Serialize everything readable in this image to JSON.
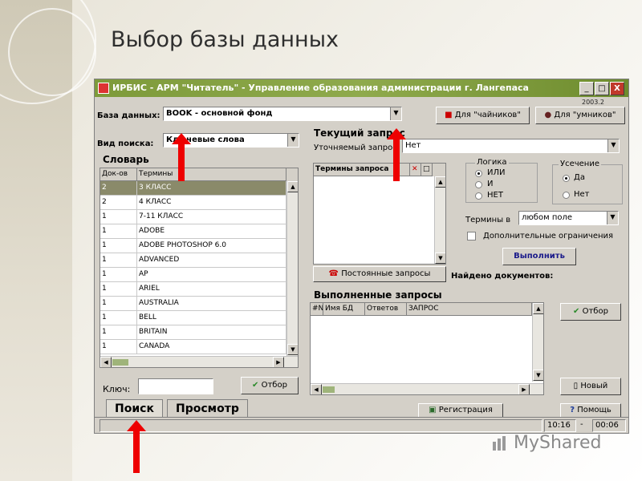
{
  "slide_title": "Выбор базы данных",
  "window": {
    "title": "ИРБИС - АРМ \"Читатель\" - Управление образования администрации г. Лангепаса",
    "version": "2003.2",
    "minimize": "_",
    "maximize": "□",
    "close": "X"
  },
  "db": {
    "label": "База данных:",
    "value": "BOOK - основной фонд",
    "btn_novice": "Для \"чайников\"",
    "btn_expert": "Для \"умников\""
  },
  "search_type": {
    "label": "Вид поиска:",
    "value": "Ключевые слова"
  },
  "dictionary": {
    "title": "Словарь",
    "headers": [
      "Док-ов",
      "Термины"
    ],
    "rows": [
      [
        "2",
        "3 КЛАСС"
      ],
      [
        "2",
        "4 КЛАСС"
      ],
      [
        "1",
        "7-11 КЛАСС"
      ],
      [
        "1",
        "ADOBE"
      ],
      [
        "1",
        "ADOBE PHOTOSHOP 6.0"
      ],
      [
        "1",
        "ADVANCED"
      ],
      [
        "1",
        "AP"
      ],
      [
        "1",
        "ARIEL"
      ],
      [
        "1",
        "AUSTRALIA"
      ],
      [
        "1",
        "BELL"
      ],
      [
        "1",
        "BRITAIN"
      ],
      [
        "1",
        "CANADA"
      ]
    ],
    "key_label": "Ключ:",
    "select_btn": "Отбор"
  },
  "current_query": {
    "title": "Текущий запрос",
    "refine_label": "Уточняемый запрос",
    "refine_value": "Нет",
    "terms_header": "Термины запроса",
    "logic_title": "Логика",
    "logic_or": "ИЛИ",
    "logic_and": "И",
    "logic_not": "НЕТ",
    "trunc_title": "Усечение",
    "trunc_yes": "Да",
    "trunc_no": "Нет",
    "terms_in_label": "Термины в",
    "terms_in_value": "любом поле",
    "extra_limits": "Дополнительные ограничения",
    "execute_btn": "Выполнить",
    "permanent_btn": "Постоянные запросы",
    "found_label": "Найдено документов:"
  },
  "done_queries": {
    "title": "Выполненные запросы",
    "headers": [
      "#N",
      "Имя БД",
      "Ответов",
      "ЗАПРОС"
    ],
    "select_btn": "Отбор",
    "new_btn": "Новый"
  },
  "tabs": [
    "Поиск",
    "Просмотр"
  ],
  "register_btn": "Регистрация",
  "help_btn": "Помощь",
  "status": {
    "time": "10:16",
    "dash": "-",
    "elapsed": "00:06"
  },
  "watermark": "MyShared",
  "colors": {
    "titlebar": "#7d9a3a",
    "selected_row": "#8a8a6a",
    "arrow": "#e00000"
  }
}
